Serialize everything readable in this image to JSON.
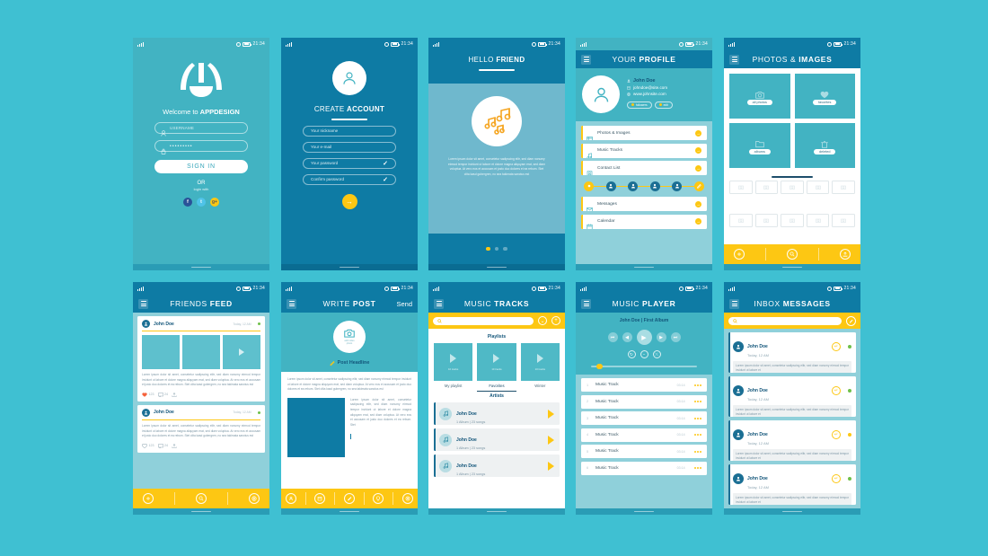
{
  "status_bar": {
    "time": "21:34"
  },
  "screens": {
    "signin": {
      "welcome_prefix": "Welcome to ",
      "welcome_brand": "APPDESIGN",
      "username_placeholder": "USERNAME",
      "password_value": "•••••••••",
      "signin_label": "SIGN IN",
      "or_label": "OR",
      "login_with_label": "login with",
      "socials": [
        {
          "name": "facebook",
          "glyph": "f"
        },
        {
          "name": "twitter",
          "glyph": "t"
        },
        {
          "name": "google-plus",
          "glyph": "g+"
        }
      ]
    },
    "create_account": {
      "title_light": "CREATE ",
      "title_bold": "ACCOUNT",
      "fields": [
        {
          "placeholder": "Your nickname",
          "checked": false
        },
        {
          "placeholder": "Your e-mail",
          "checked": false
        },
        {
          "placeholder": "Your password",
          "checked": true
        },
        {
          "placeholder": "Confirm password",
          "checked": true
        }
      ],
      "submit_glyph": "→"
    },
    "onboarding": {
      "title_light": "HELLO ",
      "title_bold": "FRIEND",
      "body": "Lorem ipsum dolor sit amet, consetetur sadipscing elitr, sed diam nonumy eirmod tempor invidunt ut labore et dolore magna aliquyam erat, sed diam voluptua. At vero eos et accusam et justo duo dolores et ea rebum. Stet clita kasd gubergren, no sea takimata sanctus est",
      "dots": 3,
      "active_dot": 0
    },
    "profile": {
      "title_light": "YOUR ",
      "title_bold": "PROFILE",
      "name": "John Doe",
      "email": "johndoe@site.com",
      "website": "www.johnsite.com",
      "tags": [
        "followers",
        "edit"
      ],
      "menu": [
        {
          "label": "Photos & Images",
          "icon": "photos-icon"
        },
        {
          "label": "Music Tracks",
          "icon": "music-icon"
        },
        {
          "label": "Contact List",
          "icon": "contact-icon"
        },
        {
          "label": "Messages",
          "icon": "mail-icon"
        },
        {
          "label": "Calendar",
          "icon": "calendar-icon"
        }
      ],
      "contacts_count": 4
    },
    "photos": {
      "title_light": "PHOTOS & ",
      "title_bold": "IMAGES",
      "tiles": [
        {
          "label": "all photos",
          "icon": "camera-icon"
        },
        {
          "label": "favorites",
          "icon": "heart-icon"
        },
        {
          "label": "albums",
          "icon": "folder-icon"
        },
        {
          "label": "deleted",
          "icon": "trash-icon"
        }
      ],
      "thumb_count": 10,
      "bottom_icons": [
        "add-icon",
        "search-icon",
        "share-icon"
      ]
    },
    "feed": {
      "title_light": "FRIENDS ",
      "title_bold": "FEED",
      "posts": [
        {
          "name": "John Doe",
          "time": "Today, 12 AM",
          "has_images": true,
          "body": "Lorem ipsum dolor sit amet, consetetur sadipscing elitr, sed diam nonumy eirmod tempor invidunt ut labore et dolore magna aliquyam erat, sed diam voluptua. At vero eos et accusam et justo duo dolores et ea rebum. Stet clita kasd gubergren, no sea takimata sanctus est",
          "likes": "123",
          "comments": "24"
        },
        {
          "name": "John Doe",
          "time": "Today, 12 AM",
          "has_images": false,
          "body": "Lorem ipsum dolor sit amet, consetetur sadipscing elitr, sed diam nonumy eirmod tempor invidunt ut labore et dolore magna aliquyam erat, sed diam voluptua. At vero eos et accusam et justo duo dolores et ea rebum. Stet clita kasd gubergren, no sea takimata sanctus est",
          "likes": "123",
          "comments": "24"
        }
      ],
      "bottom_icons": [
        "add-icon",
        "search-icon",
        "settings-icon"
      ]
    },
    "write_post": {
      "title_light": "WRITE ",
      "title_bold": "POST",
      "send_label": "Send",
      "upload_label": "add video\nphoto",
      "headline": "Post Headline",
      "body_top": "Lorem ipsum dolor sit amet, consetetur sadipscing elitr, sed diam nonumy eirmod tempor invidunt ut labore et dolore magna aliquyam erat, sed diam voluptua. At vero eos et accusam et justo duo dolores et ea rebum. Stet clita kasd gubergren, no sea takimata sanctus est",
      "body_side": "Lorem ipsum dolor sit amet, consetetur sadipscing elitr, sed diam nonumy eirmod tempor invidunt ut labore et dolore magna aliquyam erat, sed diam voluptua. At vero eos et accusam et justo duo dolores et ea rebum. Stet",
      "bottom_icons": [
        "person-icon",
        "calendar-icon",
        "edit-icon",
        "location-icon",
        "settings-icon"
      ]
    },
    "music_tracks": {
      "title_light": "MUSIC ",
      "title_bold": "TRACKS",
      "search_placeholder": "",
      "playlists_label": "Playlists",
      "playlists": [
        {
          "name": "My playlist",
          "tracks": "10 tracks",
          "active": false
        },
        {
          "name": "Favorites",
          "tracks": "10 tracks",
          "active": true
        },
        {
          "name": "Winter",
          "tracks": "10 tracks",
          "active": false
        }
      ],
      "artists_label": "Artists",
      "artists": [
        {
          "name": "John Doe",
          "sub": "1 Album | 23 songs"
        },
        {
          "name": "John Doe",
          "sub": "1 Album | 23 songs"
        },
        {
          "name": "John Doe",
          "sub": "1 Album | 23 songs"
        }
      ]
    },
    "music_player": {
      "title_light": "MUSIC ",
      "title_bold": "PLAYER",
      "now_playing": "John Doe | First Album",
      "controls": [
        "skip-start",
        "rewind",
        "play",
        "forward",
        "skip-end"
      ],
      "sub_controls": [
        "repeat-icon",
        "minus-icon",
        "shuffle-icon"
      ],
      "tracks": [
        {
          "num": "1",
          "name": "Music Track",
          "time": "03:14"
        },
        {
          "num": "2",
          "name": "Music Track",
          "time": "03:14"
        },
        {
          "num": "3",
          "name": "Music Track",
          "time": "03:14"
        },
        {
          "num": "4",
          "name": "Music Track",
          "time": "03:14"
        },
        {
          "num": "5",
          "name": "Music Track",
          "time": "03:14"
        },
        {
          "num": "6",
          "name": "Music Track",
          "time": "03:14"
        }
      ]
    },
    "inbox": {
      "title_light": "INBOX ",
      "title_bold": "MESSAGES",
      "search_placeholder": "",
      "messages": [
        {
          "name": "John Doe",
          "time": "Today, 12 AM",
          "status": "green",
          "body": "Lorem ipsum dolor sit amet, consetetur sadipscing elitr, sed diam nonumy eirmod tempor invidunt ut labore et"
        },
        {
          "name": "John Doe",
          "time": "Today, 12 AM",
          "status": "green",
          "body": "Lorem ipsum dolor sit amet, consetetur sadipscing elitr, sed diam nonumy eirmod tempor invidunt ut labore et"
        },
        {
          "name": "John Doe",
          "time": "Today, 12 AM",
          "status": "amber",
          "body": "Lorem ipsum dolor sit amet, consetetur sadipscing elitr, sed diam nonumy eirmod tempor invidunt ut labore et"
        },
        {
          "name": "John Doe",
          "time": "Today, 12 AM",
          "status": "green",
          "body": "Lorem ipsum dolor sit amet, consetetur sadipscing elitr, sed diam nonumy eirmod tempor invidunt ut labore et"
        }
      ]
    }
  },
  "colors": {
    "background": "#3fc0d2",
    "teal": "#42b3c2",
    "blue": "#0e7ba4",
    "yellow": "#fdc713",
    "navy": "#12557a",
    "green": "#6fc04a"
  }
}
